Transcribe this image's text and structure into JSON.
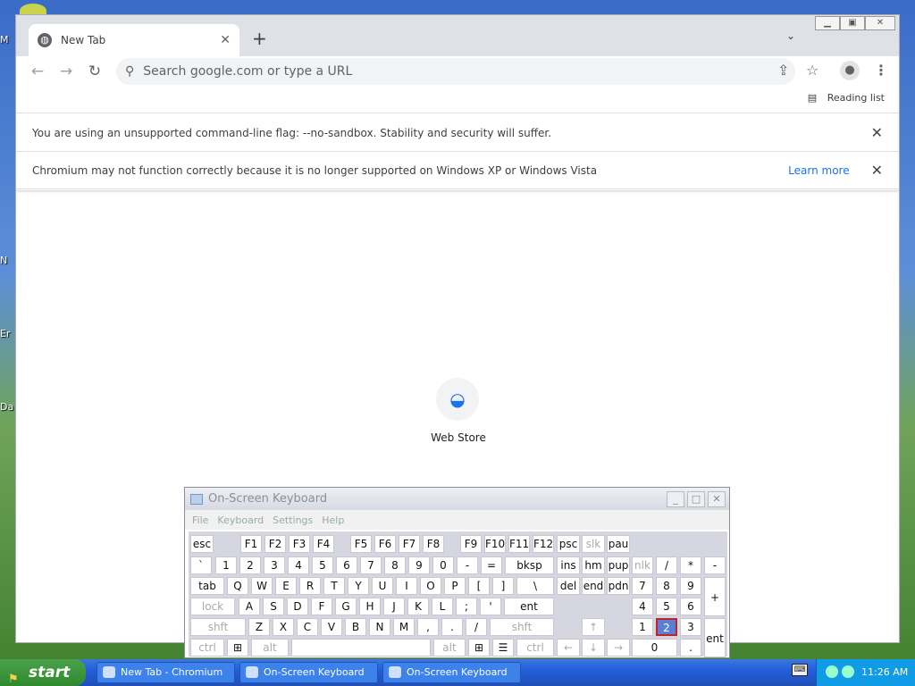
{
  "desktop": {
    "labels": [
      "M",
      "N",
      "Er",
      "Da"
    ]
  },
  "browser": {
    "tab_title": "New Tab",
    "omnibox_placeholder": "Search google.com or type a URL",
    "reading_list": "Reading list",
    "infobar1": "You are using an unsupported command-line flag: --no-sandbox. Stability and security will suffer.",
    "infobar2": "Chromium may not function correctly because it is no longer supported on Windows XP or Windows Vista",
    "learn_more": "Learn more",
    "shortcut_label": "Web Store"
  },
  "osk": {
    "title": "On-Screen Keyboard",
    "menu": [
      "File",
      "Keyboard",
      "Settings",
      "Help"
    ],
    "highlighted_key": "2"
  },
  "taskbar": {
    "start": "start",
    "buttons": [
      "New Tab - Chromium",
      "On-Screen Keyboard",
      "On-Screen Keyboard"
    ],
    "clock": "11:26 AM"
  }
}
